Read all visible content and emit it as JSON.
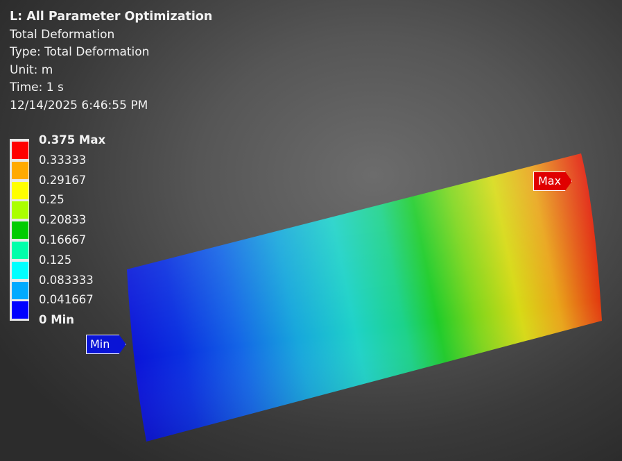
{
  "header": {
    "title": "L: All Parameter Optimization",
    "result_name": "Total Deformation",
    "type": "Type: Total Deformation",
    "unit": "Unit: m",
    "time": "Time: 1 s",
    "timestamp": "12/14/2025 6:46:55 PM"
  },
  "legend": {
    "labels": [
      "0.375 Max",
      "0.33333",
      "0.29167",
      "0.25",
      "0.20833",
      "0.16667",
      "0.125",
      "0.083333",
      "0.041667",
      "0 Min"
    ],
    "colors": [
      "#ff0000",
      "#ffaa00",
      "#ffff00",
      "#aaff00",
      "#00cc00",
      "#00ffaa",
      "#00ffff",
      "#00aaff",
      "#0000ff"
    ]
  },
  "probes": {
    "max_label": "Max",
    "min_label": "Min"
  }
}
